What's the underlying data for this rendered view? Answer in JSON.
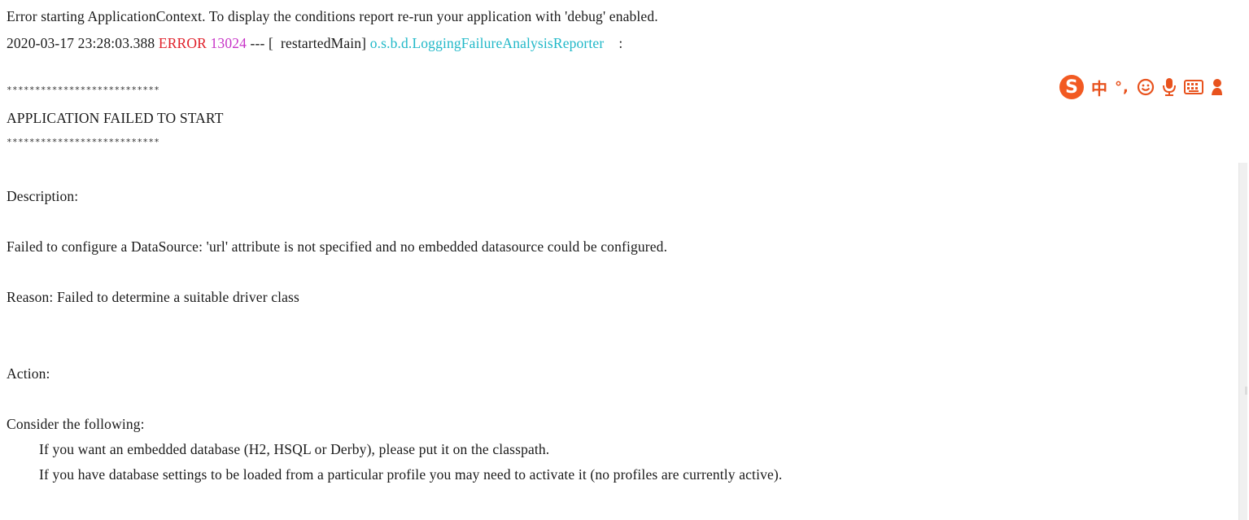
{
  "console": {
    "line1": "Error starting ApplicationContext. To display the conditions report re-run your application with 'debug' enabled.",
    "log": {
      "timestamp": "2020-03-17 23:28:03.388",
      "level": "ERROR",
      "pid": "13024",
      "sep": "--- [",
      "thread": "  restartedMain]",
      "logger": "o.s.b.d.LoggingFailureAnalysisReporter",
      "colon": ":"
    },
    "stars": "***************************",
    "banner": "APPLICATION FAILED TO START",
    "description_label": "Description:",
    "description": "Failed to configure a DataSource: 'url' attribute is not specified and no embedded datasource could be configured.",
    "reason": "Reason: Failed to determine a suitable driver class",
    "action_label": "Action:",
    "consider": "Consider the following:",
    "hint1": "If you want an embedded database (H2, HSQL or Derby), please put it on the classpath.",
    "hint2": "If you have database settings to be loaded from a particular profile you may need to activate it (no profiles are currently active)."
  },
  "ime": {
    "logo": "S",
    "lang": "中",
    "punct": "°,",
    "icons": [
      "smiley-icon",
      "microphone-icon",
      "keyboard-icon",
      "user-icon"
    ]
  },
  "colors": {
    "error": "#e0202a",
    "pid": "#c733c7",
    "logger": "#20b8c8",
    "ime": "#f25a22"
  }
}
